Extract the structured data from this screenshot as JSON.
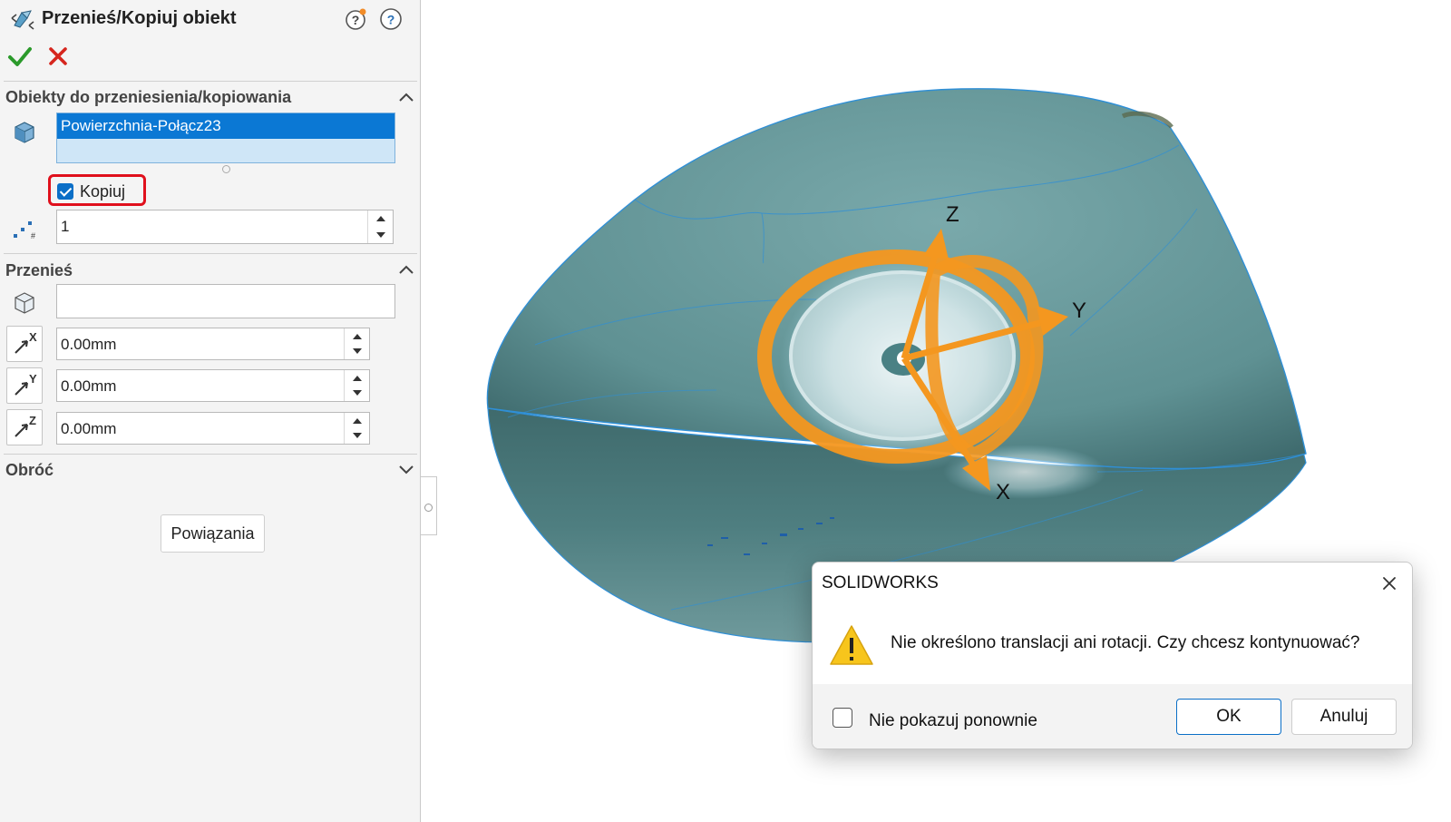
{
  "panel": {
    "title": "Przenieś/Kopiuj obiekt",
    "icons": {
      "title": "move-copy-body-icon",
      "help1": "whats-wrong-help-icon",
      "help2": "help-icon",
      "ok": "checkmark-icon",
      "cancel": "x-icon"
    },
    "objects_group": {
      "title": "Obiekty do przeniesienia/kopiowania",
      "selected_item": "Powierzchnia-Połącz23",
      "copy_label": "Kopiuj",
      "copy_checked": true,
      "count_value": "1"
    },
    "move_group": {
      "title": "Przenieś",
      "reference_value": "",
      "dx": "0.00mm",
      "dy": "0.00mm",
      "dz": "0.00mm",
      "axis_labels": [
        "X",
        "Y",
        "Z"
      ]
    },
    "rotate_group": {
      "title": "Obróć"
    },
    "constraints_button": "Powiązania"
  },
  "viewport": {
    "triad_labels": {
      "x": "X",
      "y": "Y",
      "z": "Z"
    },
    "colors": {
      "body": "#6a9c9e",
      "triad": "#f4971f",
      "edge": "#2f8fd6"
    }
  },
  "dialog": {
    "title": "SOLIDWORKS",
    "message": "Nie określono translacji ani rotacji. Czy chcesz kontynuować?",
    "checkbox_label": "Nie pokazuj ponownie",
    "ok_label": "OK",
    "cancel_label": "Anuluj"
  }
}
